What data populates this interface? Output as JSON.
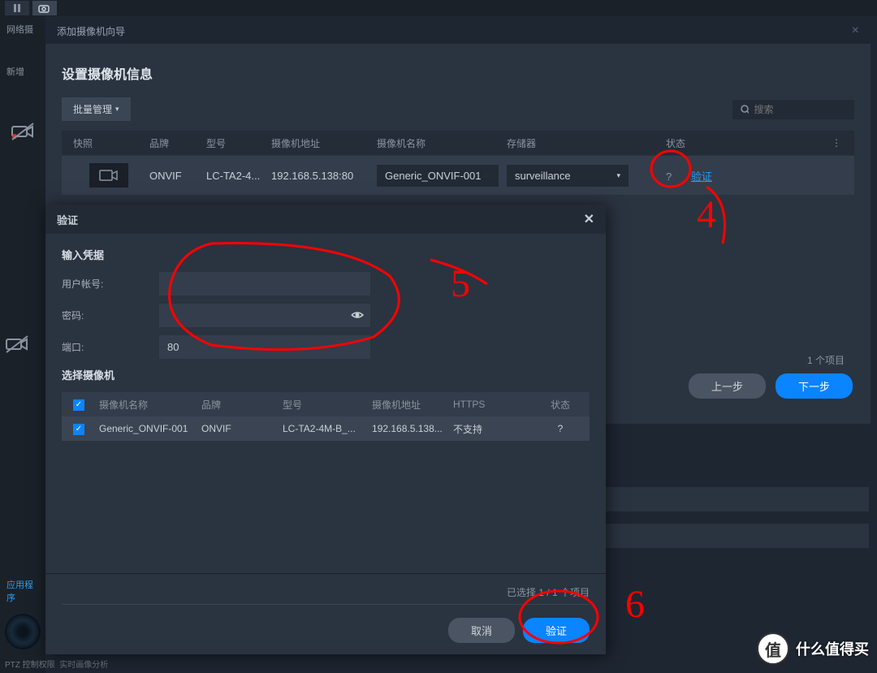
{
  "topbar": {
    "icon1": "pause",
    "icon2": "camera"
  },
  "sidebar": {
    "network_label": "网络摄",
    "add_label": "新增",
    "app_link": "应用程序",
    "ptz_label": "PTZ 控制权限",
    "realtime_label": "实时画像分析"
  },
  "wizard": {
    "header": "添加摄像机向导",
    "title": "设置摄像机信息",
    "batch_btn": "批量管理",
    "search_placeholder": "搜索",
    "columns": {
      "snapshot": "快照",
      "brand": "品牌",
      "model": "型号",
      "address": "摄像机地址",
      "name": "摄像机名称",
      "storage": "存储器",
      "status": "状态"
    },
    "row": {
      "brand": "ONVIF",
      "model": "LC-TA2-4...",
      "address": "192.168.5.138:80",
      "name": "Generic_ONVIF-001",
      "storage": "surveillance",
      "status_q": "?",
      "verify_link": "验证"
    },
    "item_count": "1 个项目",
    "prev_btn": "上一步",
    "next_btn": "下一步"
  },
  "verify": {
    "title": "验证",
    "section_creds": "输入凭据",
    "labels": {
      "username": "用户帐号:",
      "password": "密码:",
      "port": "端口:"
    },
    "values": {
      "username": "",
      "password": "",
      "port": "80"
    },
    "section_select": "选择摄像机",
    "columns": {
      "name": "摄像机名称",
      "brand": "品牌",
      "model": "型号",
      "address": "摄像机地址",
      "https": "HTTPS",
      "status": "状态"
    },
    "row": {
      "name": "Generic_ONVIF-001",
      "brand": "ONVIF",
      "model": "LC-TA2-4M-B_...",
      "address": "192.168.5.138...",
      "https": "不支持",
      "status": "?"
    },
    "selected_count": "已选择 1 / 1 个项目",
    "cancel_btn": "取消",
    "verify_btn": "验证"
  },
  "annotations": {
    "a4": "4",
    "a5": "5",
    "a6": "6"
  },
  "watermark": "什么值得买"
}
